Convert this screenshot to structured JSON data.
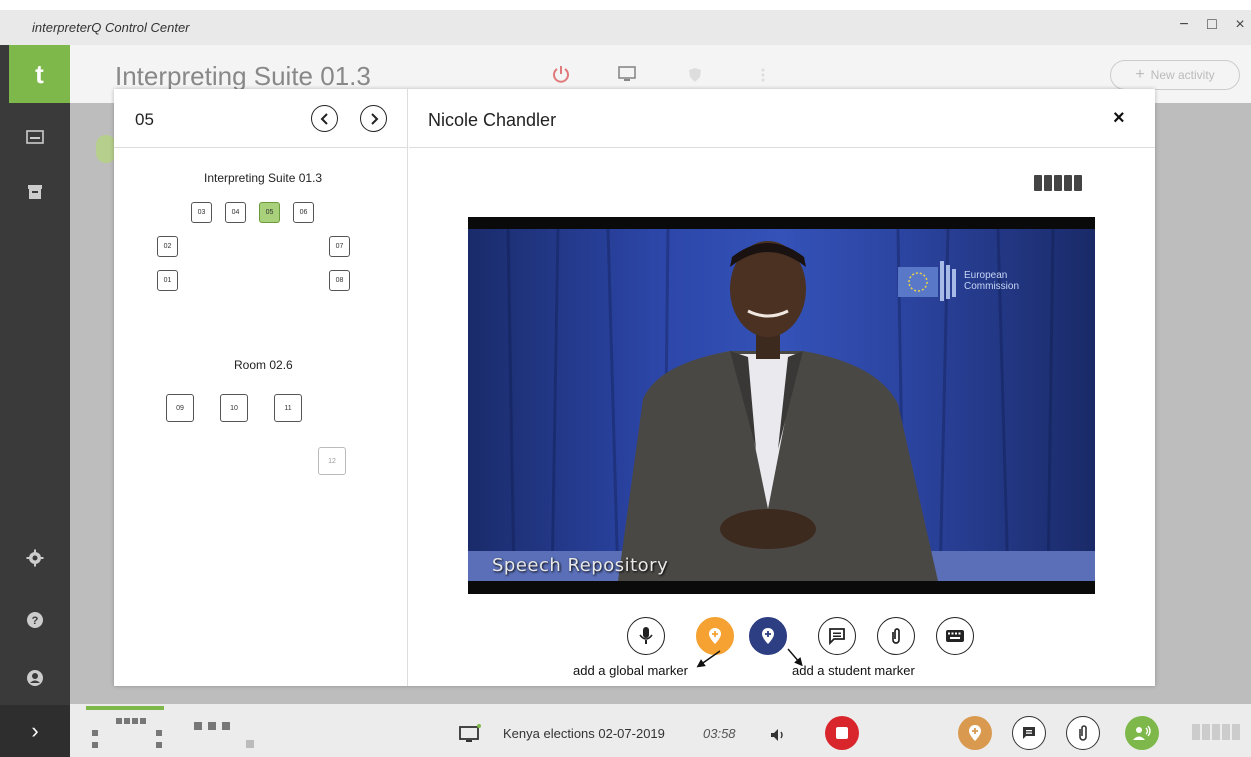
{
  "window": {
    "title": "interpreterQ Control Center",
    "controls": [
      "−",
      "□",
      "×"
    ]
  },
  "sidebar": {
    "logo": "t",
    "expand_glyph": "›"
  },
  "header": {
    "suite_title": "Interpreting Suite 01.3",
    "new_activity_label": "New activity"
  },
  "modal": {
    "booth_number": "05",
    "student_name": "Nicole Chandler",
    "close_glyph": "×",
    "rooms": [
      {
        "title": "Interpreting Suite 01.3",
        "booths": [
          "03",
          "04",
          "05",
          "06",
          "02",
          "07",
          "01",
          "08"
        ]
      },
      {
        "title": "Room 02.6",
        "booths": [
          "09",
          "10",
          "11",
          "12"
        ]
      }
    ],
    "active_booth": "05",
    "video": {
      "logo_text_1": "European",
      "logo_text_2": "Commission",
      "caption": "Speech Repository"
    },
    "annotations": {
      "global_marker": "add a global marker",
      "student_marker": "add a student marker"
    }
  },
  "bottombar": {
    "session_name": "Kenya elections 02-07-2019",
    "elapsed": "03:58"
  },
  "colors": {
    "accent_green": "#7eb84a",
    "marker_orange": "#f5a232",
    "marker_navy": "#2d3e82",
    "record_red": "#d9262c"
  }
}
